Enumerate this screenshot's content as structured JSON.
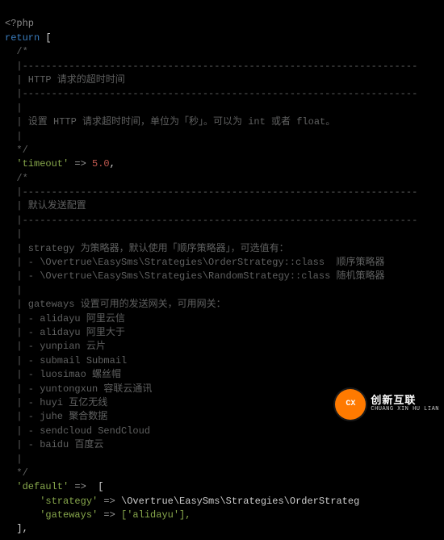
{
  "code": {
    "l1": "<?php",
    "l2_kw": "return",
    "l2_br": " [",
    "c_open": "  /*",
    "c_bar": "  |--------------------------------------------------------------------",
    "c_barv": "  |",
    "c_h1": "  | HTTP 请求的超时时间",
    "c_h1b": "  | 设置 HTTP 请求超时时间，单位为「秒」。可以为 int 或者 float。",
    "c_close": "  */",
    "timeout_key": "  'timeout'",
    "arrow": " => ",
    "timeout_val": "5.0",
    "comma": ",",
    "c_h2": "  | 默认发送配置",
    "c_s1": "  | strategy 为策略器，默认使用「顺序策略器」，可选值有：",
    "c_s1a": "  | - \\Overtrue\\EasySms\\Strategies\\OrderStrategy::class  顺序策略器",
    "c_s1b": "  | - \\Overtrue\\EasySms\\Strategies\\RandomStrategy::class 随机策略器",
    "c_g": "  | gateways 设置可用的发送网关，可用网关：",
    "c_g1": "  | - alidayu 阿里云信",
    "c_g2": "  | - alidayu 阿里大于",
    "c_g3": "  | - yunpian 云片",
    "c_g4": "  | - submail Submail",
    "c_g5": "  | - luosimao 螺丝帽",
    "c_g6": "  | - yuntongxun 容联云通讯",
    "c_g7": "  | - huyi 互亿无线",
    "c_g8": "  | - juhe 聚合数据",
    "c_g9": "  | - sendcloud SendCloud",
    "c_g10": "  | - baidu 百度云",
    "default_key": "  'default'",
    "default_open": " [",
    "strategy_key": "      'strategy'",
    "strategy_val": "\\Overtrue\\EasySms\\Strategies\\OrderStrateg",
    "gateways_key": "      'gateways'",
    "gateways_val": "['alidayu'],",
    "default_close": "  ],"
  },
  "watermark": {
    "badge": "CX",
    "cn": "创新互联",
    "en": "CHUANG XIN HU LIAN"
  }
}
